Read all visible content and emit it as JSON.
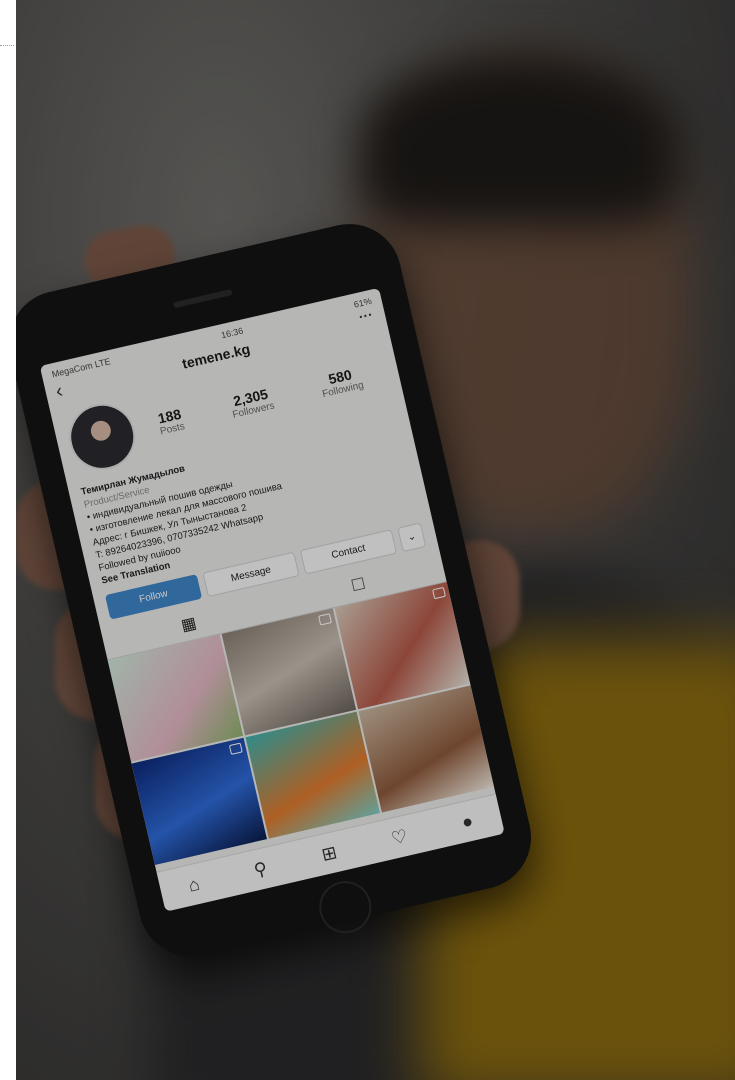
{
  "status": {
    "carrier": "MegaCom LTE",
    "time": "16:36",
    "battery": "61%"
  },
  "profile": {
    "username": "temene.kg",
    "posts_count": "188",
    "posts_label": "Posts",
    "followers_count": "2,305",
    "followers_label": "Followers",
    "following_count": "580",
    "following_label": "Following",
    "name": "Темирлан Жумадылов",
    "category": "Product/Service",
    "bio_line_1": "• индивидуальный пошив одежды",
    "bio_line_2": "• изготовление лекал для массового пошива",
    "address": "Адрес: г Бишкек, Ул Тыныстанова 2",
    "phone": "T: 89264023396, 0707335242 Whatsapp",
    "followed_by": "Followed by nuiiooo",
    "see_translation": "See Translation"
  },
  "buttons": {
    "follow": "Follow",
    "message": "Message",
    "contact": "Contact",
    "dropdown": "⌄"
  },
  "tabs": {
    "grid_icon": "grid-icon",
    "tagged_icon": "tagged-icon"
  },
  "nav": {
    "home": "home-icon",
    "search": "search-icon",
    "add": "add-icon",
    "activity": "heart-icon",
    "profile": "profile-icon"
  },
  "accent": "#3f86c8"
}
